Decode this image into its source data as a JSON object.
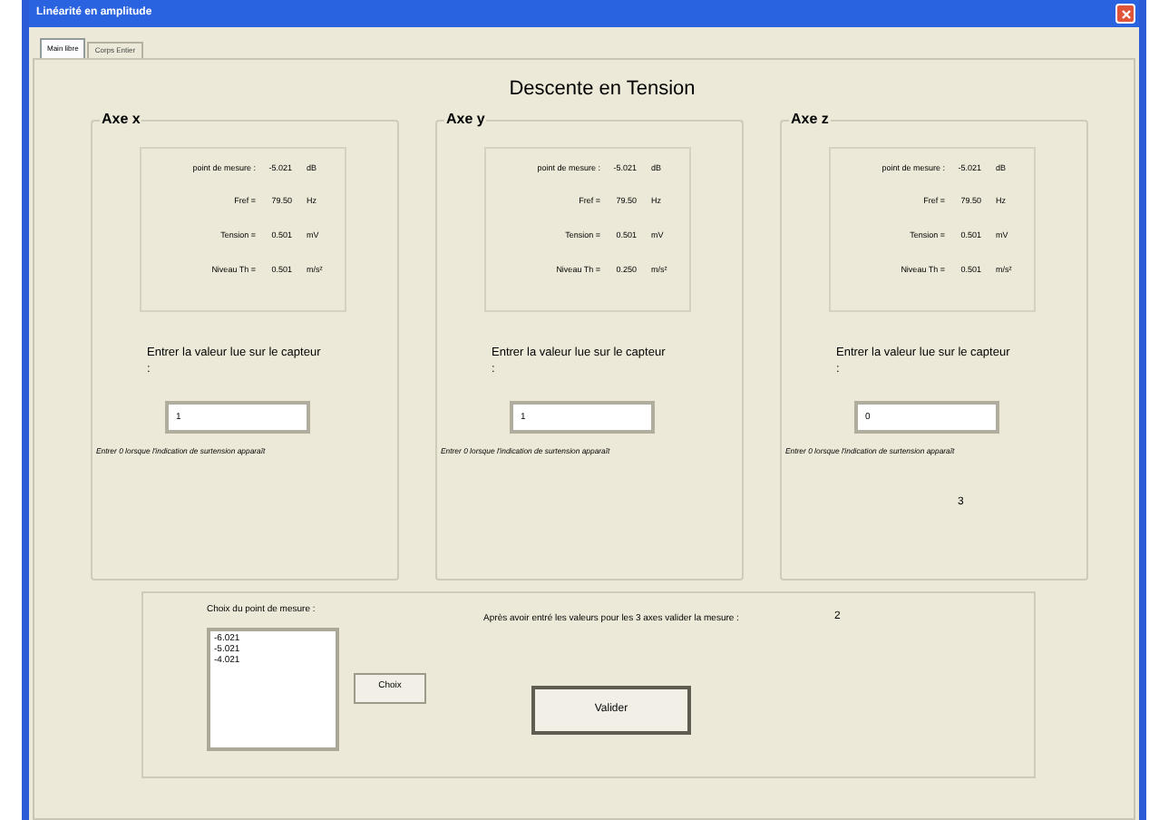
{
  "window": {
    "title": "Linéarité en amplitude"
  },
  "tabs": [
    {
      "label": "Main libre",
      "selected": true
    },
    {
      "label": "Corps Entier",
      "selected": false
    }
  ],
  "heading": "Descente en Tension",
  "axes": [
    {
      "title": "Axe x",
      "readings": [
        {
          "label": "point de mesure :",
          "value": "-5.021",
          "unit": "dB"
        },
        {
          "label": "Fref =",
          "value": "79.50",
          "unit": "Hz"
        },
        {
          "label": "Tension =",
          "value": "0.501",
          "unit": "mV"
        },
        {
          "label": "Niveau Th =",
          "value": "0.501",
          "unit": "m/s²"
        }
      ],
      "prompt": "Entrer la valeur lue sur le capteur :",
      "value": "1",
      "note": "Entrer 0 lorsque l'indication de surtension apparaît"
    },
    {
      "title": "Axe y",
      "readings": [
        {
          "label": "point de mesure :",
          "value": "-5.021",
          "unit": "dB"
        },
        {
          "label": "Fref =",
          "value": "79.50",
          "unit": "Hz"
        },
        {
          "label": "Tension =",
          "value": "0.501",
          "unit": "mV"
        },
        {
          "label": "Niveau Th =",
          "value": "0.250",
          "unit": "m/s²"
        }
      ],
      "prompt": "Entrer la valeur lue sur le capteur :",
      "value": "1",
      "note": "Entrer 0 lorsque l'indication de surtension apparaît"
    },
    {
      "title": "Axe z",
      "readings": [
        {
          "label": "point de mesure :",
          "value": "-5.021",
          "unit": "dB"
        },
        {
          "label": "Fref =",
          "value": "79.50",
          "unit": "Hz"
        },
        {
          "label": "Tension =",
          "value": "0.501",
          "unit": "mV"
        },
        {
          "label": "Niveau Th =",
          "value": "0.501",
          "unit": "m/s²"
        }
      ],
      "prompt": "Entrer la valeur lue sur le capteur :",
      "value": "0",
      "note": "Entrer 0 lorsque l'indication de surtension apparaît",
      "counter": "3"
    }
  ],
  "bottom": {
    "list_label": "Choix du point de mesure :",
    "list_items": [
      "-6.021",
      "-5.021",
      "-4.021"
    ],
    "choose_button": "Choix",
    "instruction": "Après avoir entré les valeurs pour les 3 axes valider la mesure :",
    "counter": "2",
    "validate_button": "Valider"
  }
}
